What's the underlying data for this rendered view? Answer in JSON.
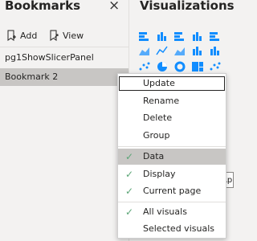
{
  "bookmarks": {
    "title": "Bookmarks",
    "close_glyph": "×",
    "add_label": "Add",
    "view_label": "View",
    "items": [
      {
        "label": "pg1ShowSlicerPanel"
      },
      {
        "label": "Bookmark 2"
      }
    ],
    "more_glyph": "···"
  },
  "visualizations": {
    "title": "Visualizations",
    "icons": [
      "stacked-bar-chart-icon",
      "stacked-column-chart-icon",
      "clustered-bar-chart-icon",
      "clustered-column-chart-icon",
      "100-percent-bar-icon",
      "area-chart-icon",
      "line-chart-icon",
      "stacked-area-chart-icon",
      "line-and-column-chart-icon",
      "ribbon-chart-icon",
      "scatter-chart-icon",
      "pie-chart-icon",
      "donut-chart-icon",
      "treemap-icon",
      "map-icon"
    ],
    "tooltip_fragment": "Ap"
  },
  "context_menu": {
    "group1": [
      "Update",
      "Rename",
      "Delete",
      "Group"
    ],
    "group2": [
      {
        "label": "Data",
        "checked": true
      },
      {
        "label": "Display",
        "checked": true
      },
      {
        "label": "Current page",
        "checked": true
      }
    ],
    "group3": [
      {
        "label": "All visuals",
        "checked": true
      },
      {
        "label": "Selected visuals",
        "checked": false
      }
    ],
    "check_glyph": "✓"
  },
  "colors": {
    "selection_gray": "#c8c6c4",
    "check_green": "#5ba576",
    "viz_icon_blue": "#118dff"
  }
}
